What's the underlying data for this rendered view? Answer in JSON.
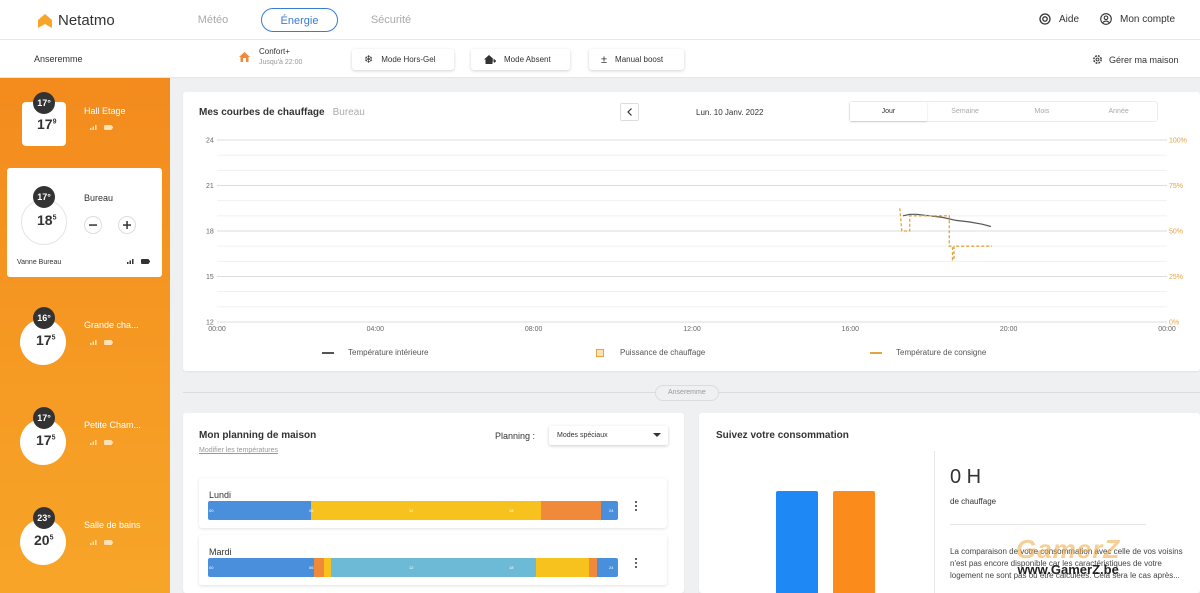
{
  "app": {
    "logo_text": "Netatmo",
    "brand_color": "#f7a528",
    "accent": "#3a7bd5"
  },
  "nav": {
    "tabs": [
      {
        "label": "Météo",
        "active": false
      },
      {
        "label": "Énergie",
        "active": true
      },
      {
        "label": "Sécurité",
        "active": false
      }
    ],
    "aide": "Aide",
    "account": "Mon compte"
  },
  "subbar": {
    "home_name": "Anseremme",
    "mode_title": "Confort+",
    "mode_until": "Jusqu'à 22:00",
    "buttons": [
      "Mode Hors-Gel",
      "Mode Absent",
      "Manual boost"
    ],
    "manage": "Gérer ma maison"
  },
  "rooms": [
    {
      "name": "Hall Etage",
      "setpoint": "17°",
      "current": "17",
      "decimal": "9",
      "selected": false
    },
    {
      "name": "Bureau",
      "setpoint": "17°",
      "current": "18",
      "decimal": "5",
      "selected": true,
      "device": "Vanne Bureau"
    },
    {
      "name": "Grande cha...",
      "setpoint": "16°",
      "current": "17",
      "decimal": "5",
      "selected": false
    },
    {
      "name": "Petite Cham...",
      "setpoint": "17°",
      "current": "17",
      "decimal": "5",
      "selected": false
    },
    {
      "name": "Salle de bains",
      "setpoint": "23°",
      "current": "20",
      "decimal": "5",
      "selected": false
    }
  ],
  "heating_chart": {
    "title": "Mes courbes de chauffage",
    "room": "Bureau",
    "date": "Lun. 10 Janv. 2022",
    "periods": [
      {
        "label": "Jour",
        "active": true
      },
      {
        "label": "Semaine",
        "active": false
      },
      {
        "label": "Mois",
        "active": false
      },
      {
        "label": "Année",
        "active": false
      }
    ],
    "legend": [
      "Température intérieure",
      "Puissance de chauffage",
      "Température de consigne"
    ]
  },
  "chart_data": {
    "type": "line",
    "x_ticks": [
      "00:00",
      "04:00",
      "08:00",
      "12:00",
      "16:00",
      "20:00",
      "00:00"
    ],
    "ylim": [
      12,
      24
    ],
    "y_ticks": [
      24,
      21,
      18,
      15,
      12
    ],
    "y2lim": [
      0,
      100
    ],
    "y2_ticks": [
      "100%",
      "75%",
      "50%",
      "25%",
      "0%"
    ],
    "grid": true,
    "series": [
      {
        "name": "Température intérieure",
        "color": "#555555",
        "style": "solid",
        "points": [
          [
            17.33,
            19.0
          ],
          [
            17.5,
            19.1
          ],
          [
            17.67,
            19.1
          ],
          [
            18.0,
            19.0
          ],
          [
            18.33,
            18.9
          ],
          [
            18.67,
            18.7
          ],
          [
            19.0,
            18.6
          ],
          [
            19.33,
            18.45
          ],
          [
            19.55,
            18.3
          ]
        ]
      },
      {
        "name": "Température de consigne",
        "color": "#e5a33d",
        "style": "dashed",
        "points": [
          [
            17.25,
            19.5
          ],
          [
            17.3,
            18.0
          ],
          [
            17.5,
            18.0
          ],
          [
            17.5,
            19.0
          ],
          [
            18.5,
            19.0
          ],
          [
            18.5,
            17.0
          ],
          [
            18.58,
            17.0
          ],
          [
            18.58,
            16.1
          ],
          [
            18.62,
            16.1
          ],
          [
            18.62,
            17.0
          ],
          [
            19.58,
            17.0
          ]
        ]
      }
    ]
  },
  "planning": {
    "title": "Mon planning de maison",
    "edit_link": "Modifier les températures",
    "label": "Planning :",
    "selected": "Modes spéciaux",
    "days": [
      {
        "name": "Lundi",
        "segments": [
          [
            0,
            6,
            "#4a8fdb"
          ],
          [
            6,
            19.5,
            "#f7c21e"
          ],
          [
            19.5,
            23,
            "#f08a3a"
          ],
          [
            23,
            24,
            "#4a8fdb"
          ]
        ]
      },
      {
        "name": "Mardi",
        "segments": [
          [
            0,
            6.2,
            "#4a8fdb"
          ],
          [
            6.2,
            6.8,
            "#f08a3a"
          ],
          [
            6.8,
            7.2,
            "#f7c21e"
          ],
          [
            7.2,
            19.2,
            "#6dbad6"
          ],
          [
            19.2,
            22.3,
            "#f7c21e"
          ],
          [
            22.3,
            22.8,
            "#f08a3a"
          ],
          [
            22.8,
            24,
            "#4a8fdb"
          ]
        ]
      }
    ],
    "bar_ticks": [
      "00",
      "06",
      "12",
      "18",
      "24"
    ]
  },
  "consumption": {
    "title": "Suivez votre consommation",
    "hours": "0 H",
    "hours_label": "de chauffage",
    "note": "La comparaison de votre consommation avec celle de vos voisins n'est pas encore disponible car les caractéristiques de votre logement ne sont pas ou être calculées. Cela sera le cas après...",
    "bars": [
      {
        "color": "#1e88f5",
        "value": 1
      },
      {
        "color": "#fb8c1c",
        "value": 1
      }
    ]
  },
  "footer_divider": "Anseremme",
  "watermark": {
    "line1": "GamerZ",
    "line2": "www.GamerZ.be"
  }
}
